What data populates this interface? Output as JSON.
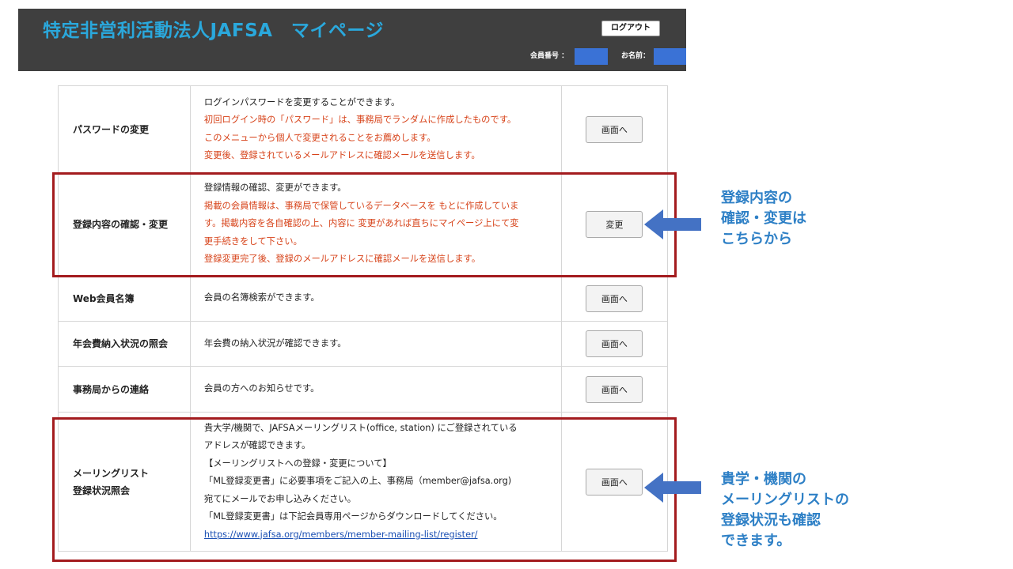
{
  "header": {
    "title": "特定非営利活動法人JAFSA　マイページ",
    "logout_label": "ログアウト",
    "member_no_label": "会員番号 ：",
    "name_label": "お名前："
  },
  "menu": [
    {
      "label": [
        "パスワードの変更"
      ],
      "lines": [
        {
          "text": "ログインパスワードを変更することができます。",
          "style": "normal"
        },
        {
          "text": "初回ログイン時の「パスワード」は、事務局でランダムに作成したものです。",
          "style": "red"
        },
        {
          "text": "このメニューから個人で変更されることをお薦めします。",
          "style": "red"
        },
        {
          "text": "変更後、登録されているメールアドレスに確認メールを送信します。",
          "style": "red"
        }
      ],
      "button": "画面へ",
      "height": 110
    },
    {
      "label": [
        "登録内容の確認・変更"
      ],
      "lines": [
        {
          "text": "登録情報の確認、変更ができます。",
          "style": "normal"
        },
        {
          "text": "掲載の会員情報は、事務局で保管しているデータベースを もとに作成していま",
          "style": "red"
        },
        {
          "text": "す。掲載内容を各自確認の上、内容に 変更があれば直ちにマイページ上にて変",
          "style": "red"
        },
        {
          "text": "更手続きをして下さい。",
          "style": "red"
        },
        {
          "text": "登録変更完了後、登録のメールアドレスに確認メールを送信します。",
          "style": "red"
        }
      ],
      "button": "変更",
      "height": 130
    },
    {
      "label": [
        "Web会員名簿"
      ],
      "lines": [
        {
          "text": "会員の名簿検索ができます。",
          "style": "normal"
        }
      ],
      "button": "画面へ",
      "height": 58
    },
    {
      "label": [
        "年会費納入状況の照会"
      ],
      "lines": [
        {
          "text": "年会費の納入状況が確認できます。",
          "style": "normal"
        }
      ],
      "button": "画面へ",
      "height": 57
    },
    {
      "label": [
        "事務局からの連絡"
      ],
      "lines": [
        {
          "text": "会員の方へのお知らせです。",
          "style": "normal"
        }
      ],
      "button": "画面へ",
      "height": 58
    },
    {
      "label": [
        "メーリングリスト",
        "登録状況照会"
      ],
      "lines": [
        {
          "text": "貴大学/機関で、JAFSAメーリングリスト(office, station) にご登録されている",
          "style": "normal"
        },
        {
          "text": "アドレスが確認できます。",
          "style": "normal"
        },
        {
          "text": "【メーリングリストへの登録・変更について】",
          "style": "normal"
        },
        {
          "text": "「ML登録変更書」に必要事項をご記入の上、事務局（member@jafsa.org)",
          "style": "normal"
        },
        {
          "text": "宛てにメールでお申し込みください。",
          "style": "normal"
        },
        {
          "text": "「ML登録変更書」は下記会員専用ページからダウンロードしてください。",
          "style": "normal"
        },
        {
          "text": "https://www.jafsa.org/members/member-mailing-list/register/",
          "style": "link"
        }
      ],
      "button": "画面へ",
      "height": 176
    }
  ],
  "annotations": [
    {
      "lines": [
        "登録内容の",
        "確認・変更は",
        "こちらから"
      ]
    },
    {
      "lines": [
        "貴学・機関の",
        "メーリングリストの",
        "登録状況も確認",
        "できます。"
      ]
    }
  ],
  "colors": {
    "header_bg": "#3f3f3f",
    "title": "#2aa8dc",
    "red_text": "#d7431a",
    "highlight": "#a31b1e",
    "note": "#2e80c6",
    "arrow": "#4472c4"
  }
}
